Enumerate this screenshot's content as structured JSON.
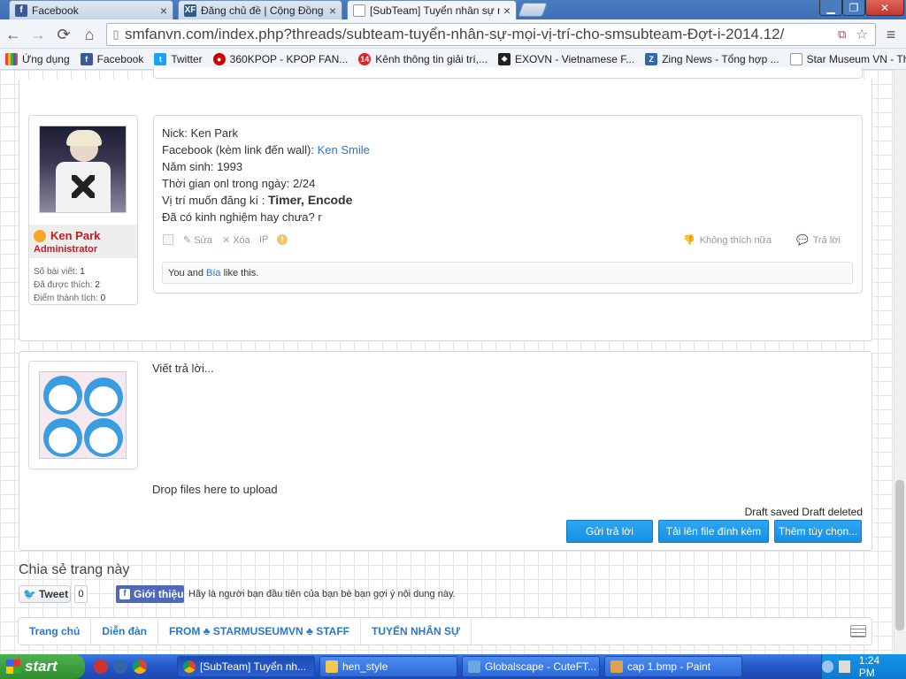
{
  "browser": {
    "tabs": [
      {
        "title": "Facebook",
        "fav": "f",
        "color": "#3b5998"
      },
      {
        "title": "Đăng chủ đề | Cộng Đồng Xe",
        "fav": "XF",
        "color": "#2b5c8a"
      },
      {
        "title": "[SubTeam] Tuyển nhân sự m",
        "fav": "",
        "color": "#ffffff"
      }
    ],
    "url": "smfanvn.com/index.php?threads/subteam-tuyển-nhân-sự-mọi-vị-trí-cho-smsubteam-Đợt-i-2014.12/",
    "bookmarks": [
      {
        "label": "Ứng dụng",
        "icon": "apps-icon",
        "color": "#e44"
      },
      {
        "label": "Facebook",
        "icon": "facebook-icon",
        "color": "#3b5998"
      },
      {
        "label": "Twitter",
        "icon": "twitter-icon",
        "color": "#1da1f2"
      },
      {
        "label": "360KPOP - KPOP FAN...",
        "icon": "360kpop-icon",
        "color": "#c00"
      },
      {
        "label": "Kênh thông tin giải trí,...",
        "icon": "channel14-icon",
        "color": "#d22"
      },
      {
        "label": "EXOVN - Vietnamese F...",
        "icon": "exovn-icon",
        "color": "#222"
      },
      {
        "label": "Zing News - Tổng hợp ...",
        "icon": "zing-icon",
        "color": "#3366aa"
      },
      {
        "label": "Star Museum VN - The...",
        "icon": "page-icon",
        "color": "#aaa"
      }
    ],
    "more": "»"
  },
  "post": {
    "username": "Ken Park",
    "role": "Administrator",
    "stats": [
      {
        "label": "Số bài viết:",
        "value": "1"
      },
      {
        "label": "Đã được thích:",
        "value": "2"
      },
      {
        "label": "Điểm thành tích:",
        "value": "0"
      }
    ],
    "lines": {
      "nick": "Nick: Ken Park",
      "facebook_label": "Facebook (kèm link đến wall): ",
      "facebook_link": "Ken Smile",
      "birth": "Năm sinh: 1993",
      "online": "Thời gian onl trong ngày: 2/24",
      "position_label": "Vị trí muốn đăng kí : ",
      "position_value": "Timer, Encode",
      "experience": "Đã có kinh nghiệm hay chưa? r"
    },
    "actions": {
      "edit": "Sửa",
      "delete": "Xóa",
      "ip": "IP",
      "unlike": "Không thích nữa",
      "reply": "Trả lời"
    },
    "likes": {
      "you_and": "You and ",
      "liker": "Bía",
      "suffix": " like this."
    }
  },
  "reply": {
    "placeholder": "Viết trả lời...",
    "drop": "Drop files here to upload",
    "draft_status": "Draft saved Draft deleted",
    "buttons": {
      "send": "Gửi trả lời",
      "upload": "Tải lên file đính kèm",
      "more": "Thêm tùy chọn..."
    }
  },
  "share": {
    "title": "Chia sẻ trang này",
    "tweet": "Tweet",
    "tweet_count": "0",
    "fb": "Giới thiệu",
    "fb_text": "Hãy là người bạn đầu tiên của bạn bè bạn gợi ý nội dung này."
  },
  "breadcrumb": [
    "Trang chủ",
    "Diễn đàn",
    "FROM ♣ STARMUSEUMVN ♣ STAFF",
    "TUYỂN NHÂN SỰ"
  ],
  "taskbar": {
    "start": "start",
    "tasks": [
      {
        "label": "[SubTeam] Tuyển nh...",
        "color": "#e8a21c"
      },
      {
        "label": "hen_style",
        "color": "#f3c94f"
      },
      {
        "label": "Globalscape - CuteFT...",
        "color": "#6aa8e0"
      },
      {
        "label": "cap 1.bmp - Paint",
        "color": "#e0a050"
      }
    ],
    "clock": "1:24 PM"
  }
}
